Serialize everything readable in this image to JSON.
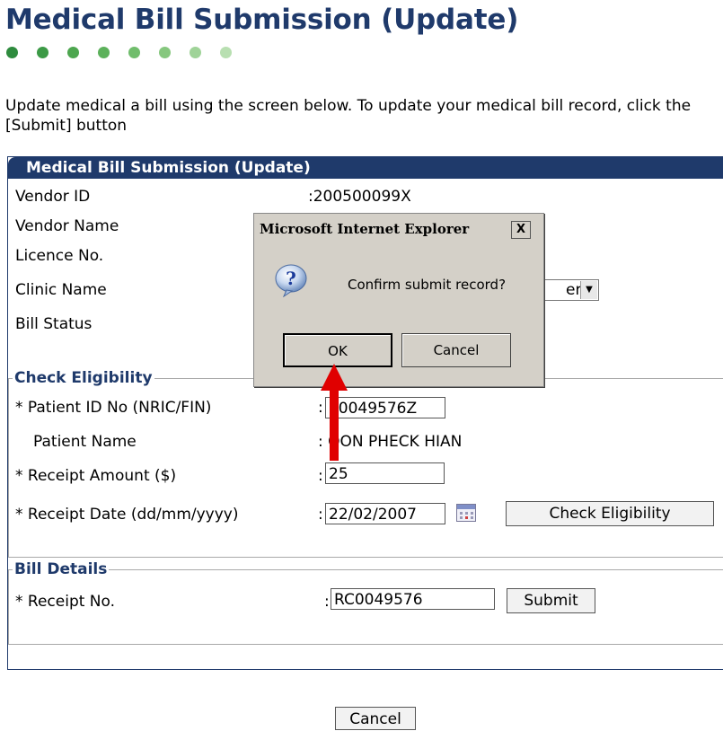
{
  "page": {
    "title": "Medical Bill Submission (Update)",
    "intro": "Update medical a bill using the screen below. To update your medical bill record, click the [Submit] button",
    "dot_colors": [
      "#2e8b3e",
      "#3c9a46",
      "#4da64f",
      "#5cb15b",
      "#70bd6c",
      "#86c77e",
      "#9fd398",
      "#b8dfb1"
    ]
  },
  "panel": {
    "title": "Medical Bill Submission (Update)",
    "rows": [
      {
        "label": "Vendor ID",
        "value": ":200500099X"
      },
      {
        "label": "Vendor Name",
        "value": ""
      },
      {
        "label": "Licence No.",
        "value": ""
      },
      {
        "label": "Clinic Name",
        "value": "ery"
      },
      {
        "label": "Bill Status",
        "value": ""
      }
    ]
  },
  "eligibility": {
    "legend": "Check Eligibility",
    "patient_id_label": "* Patient ID No (NRIC/FIN)",
    "patient_id_value": "S0049576Z",
    "patient_name_label": "Patient Name",
    "patient_name_value": ": OON PHECK HIAN",
    "receipt_amount_label": "* Receipt Amount ($)",
    "receipt_amount_value": "25",
    "receipt_date_label": "* Receipt Date (dd/mm/yyyy)",
    "receipt_date_value": "22/02/2007",
    "check_button": "Check Eligibility",
    "colon": ":"
  },
  "bill_details": {
    "legend": "Bill Details",
    "receipt_no_label": "* Receipt No.",
    "receipt_no_value": "RC0049576",
    "submit_button": "Submit",
    "colon": ":"
  },
  "footer": {
    "cancel_button": "Cancel"
  },
  "dialog": {
    "title": "Microsoft Internet Explorer",
    "message": "Confirm submit record?",
    "ok_button": "OK",
    "cancel_button": "Cancel",
    "close_glyph": "X",
    "icon": "question-icon"
  },
  "annotation": {
    "arrow_color": "#e00000"
  }
}
